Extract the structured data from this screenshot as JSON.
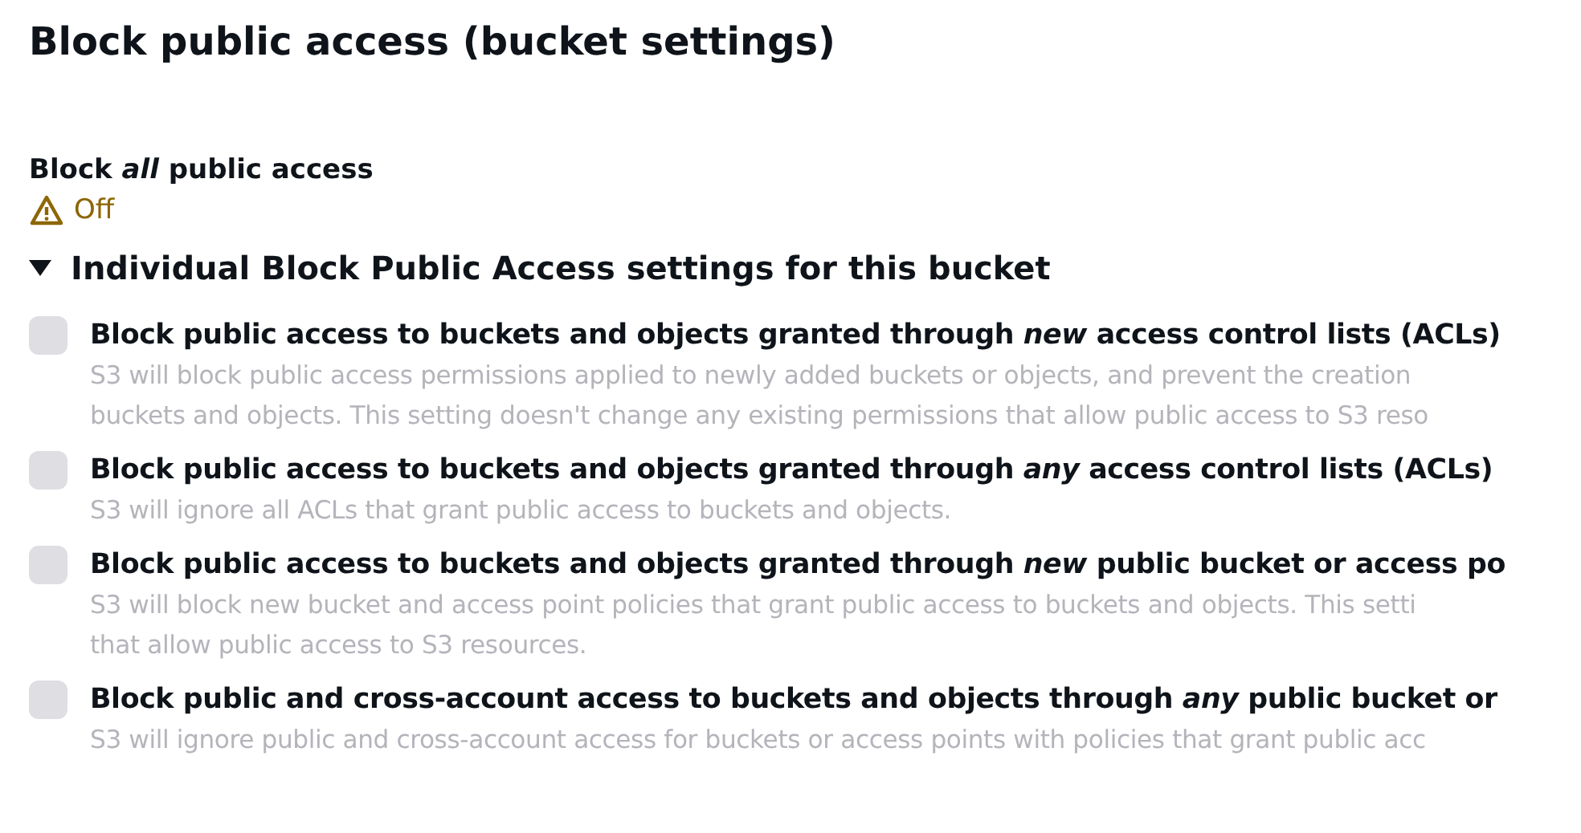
{
  "title": "Block public access (bucket settings)",
  "block_all": {
    "label": "Block *all* public access",
    "status": "Off",
    "on": false
  },
  "section": {
    "title": "Individual Block Public Access settings for this bucket",
    "expanded": true
  },
  "settings": [
    {
      "title": "Block public access to buckets and objects granted through *new* access control lists (ACLs)",
      "description": [
        "S3 will block public access permissions applied to newly added buckets or objects, and prevent the creation",
        "buckets and objects. This setting doesn't change any existing permissions that allow public access to S3 reso"
      ],
      "checked": false,
      "disabled": true
    },
    {
      "title": "Block public access to buckets and objects granted through *any* access control lists (ACLs)",
      "description": [
        "S3 will ignore all ACLs that grant public access to buckets and objects."
      ],
      "checked": false,
      "disabled": true
    },
    {
      "title": "Block public access to buckets and objects granted through *new* public bucket or access po",
      "description": [
        "S3 will block new bucket and access point policies that grant public access to buckets and objects. This setti",
        "that allow public access to S3 resources."
      ],
      "checked": false,
      "disabled": true
    },
    {
      "title": "Block public and cross-account access to buckets and objects through *any* public bucket or",
      "description": [
        "S3 will ignore public and cross-account access for buckets or access points with policies that grant public acc"
      ],
      "checked": false,
      "disabled": true
    }
  ]
}
